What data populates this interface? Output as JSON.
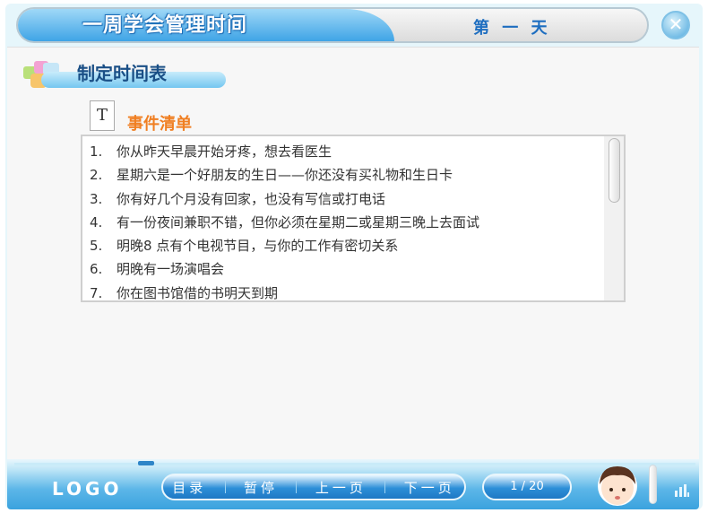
{
  "header": {
    "title": "一周学会管理时间",
    "day": "第 一 天",
    "close_symbol": "✕"
  },
  "section": {
    "title": "制定时间表",
    "doc_icon_letter": "T",
    "list_title": "事件清单"
  },
  "events": [
    {
      "num": "1.",
      "text": "你从昨天早晨开始牙疼，想去看医生"
    },
    {
      "num": "2.",
      "text": "星期六是一个好朋友的生日——你还没有买礼物和生日卡"
    },
    {
      "num": "3.",
      "text": "你有好几个月没有回家，也没有写信或打电话"
    },
    {
      "num": "4.",
      "text": "有一份夜间兼职不错，但你必须在星期二或星期三晚上去面试"
    },
    {
      "num": "5.",
      "text": "明晚8 点有个电视节目，与你的工作有密切关系"
    },
    {
      "num": "6.",
      "text": "明晚有一场演唱会"
    },
    {
      "num": "7.",
      "text": "你在图书馆借的书明天到期"
    }
  ],
  "footer": {
    "logo": "LOGO",
    "nav": {
      "menu": "目录",
      "pause": "暂停",
      "prev": "上一页",
      "next": "下一页"
    },
    "page_indicator": "1 / 20"
  },
  "colors": {
    "accent_blue": "#2d8fd8",
    "title_orange": "#f07f22",
    "section_title": "#1a4f86"
  }
}
